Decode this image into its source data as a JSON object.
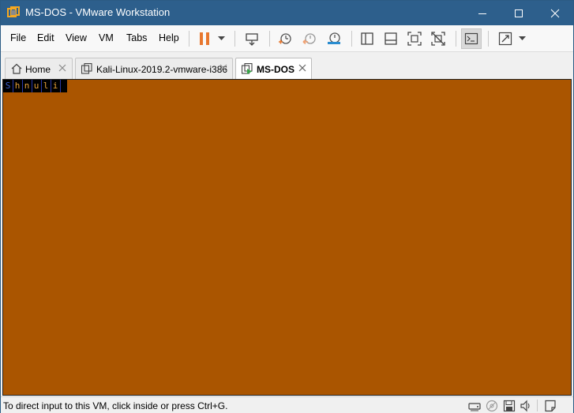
{
  "window": {
    "title": "MS-DOS - VMware Workstation"
  },
  "menu": {
    "items": [
      {
        "id": "file",
        "label": "File"
      },
      {
        "id": "edit",
        "label": "Edit"
      },
      {
        "id": "view",
        "label": "View"
      },
      {
        "id": "vm",
        "label": "VM"
      },
      {
        "id": "tabs",
        "label": "Tabs"
      },
      {
        "id": "help",
        "label": "Help"
      }
    ]
  },
  "toolbar": {
    "icons": [
      "pause-icon",
      "send-ctrl-alt-del-icon",
      "snapshot-icon",
      "revert-snapshot-icon",
      "snapshot-manager-icon",
      "show-library-icon",
      "thumbnail-bar-icon",
      "full-screen-icon",
      "unity-icon",
      "console-view-icon",
      "stretch-guest-icon"
    ],
    "accent_pause": "#e8772e"
  },
  "tabs": [
    {
      "id": "home",
      "label": "Home",
      "icon": "home-icon",
      "active": false
    },
    {
      "id": "kali",
      "label": "Kali-Linux-2019.2-vmware-i386",
      "icon": "vm-icon",
      "active": false
    },
    {
      "id": "msdos",
      "label": "MS-DOS",
      "icon": "vm-running-icon",
      "active": true
    }
  ],
  "vm": {
    "background": "#aa5500",
    "screen_text": "Shnuli"
  },
  "statusbar": {
    "text": "To direct input to this VM, click inside or press Ctrl+G.",
    "icons": [
      "hard-disk-icon",
      "cd-rom-icon",
      "floppy-icon",
      "sound-icon",
      "messages-icon"
    ]
  }
}
